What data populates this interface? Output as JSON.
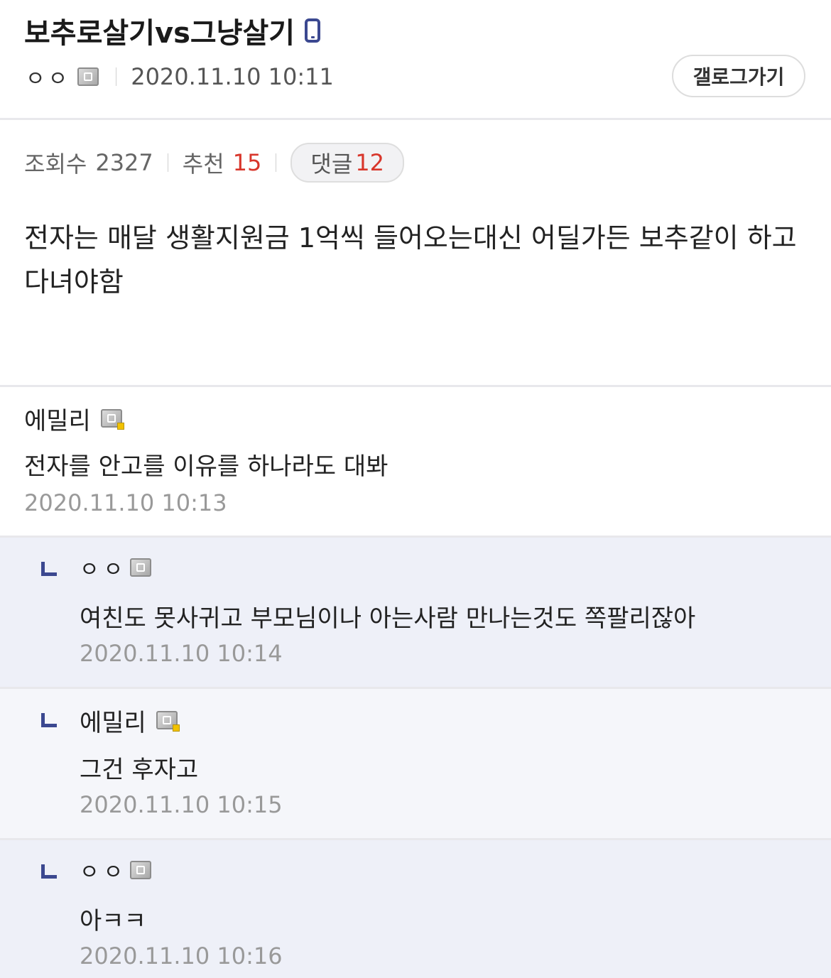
{
  "post": {
    "title": "보추로살기vs그냥살기",
    "title_icon": "mobile-icon",
    "author": "ㅇㅇ",
    "date": "2020.11.10 10:11",
    "gallery_button": "갤로그가기",
    "views_label": "조회수",
    "views_value": "2327",
    "recommend_label": "추천",
    "recommend_value": "15",
    "comments_label": "댓글",
    "comments_value": "12",
    "body": "전자는 매달 생활지원금 1억씩 들어오는대신 어딜가든 보추같이 하고다녀야함"
  },
  "comments": [
    {
      "author": "에밀리",
      "text": "전자를 안고를 이유를 하나라도 대봐",
      "date": "2020.11.10 10:13"
    },
    {
      "author": "ㅇㅇ",
      "text": "여친도 못사귀고 부모님이나 아는사람 만나는것도 쪽팔리잖아",
      "date": "2020.11.10 10:14"
    },
    {
      "author": "에밀리",
      "text": "그건 후자고",
      "date": "2020.11.10 10:15"
    },
    {
      "author": "ㅇㅇ",
      "text": "아ㅋㅋ",
      "date": "2020.11.10 10:16"
    }
  ],
  "colors": {
    "accent": "#3b4890",
    "count_red": "#d8362b",
    "reply_bg": "#eef0f8",
    "reply_bg_alt": "#f5f6fa",
    "date_gray": "#999999"
  }
}
